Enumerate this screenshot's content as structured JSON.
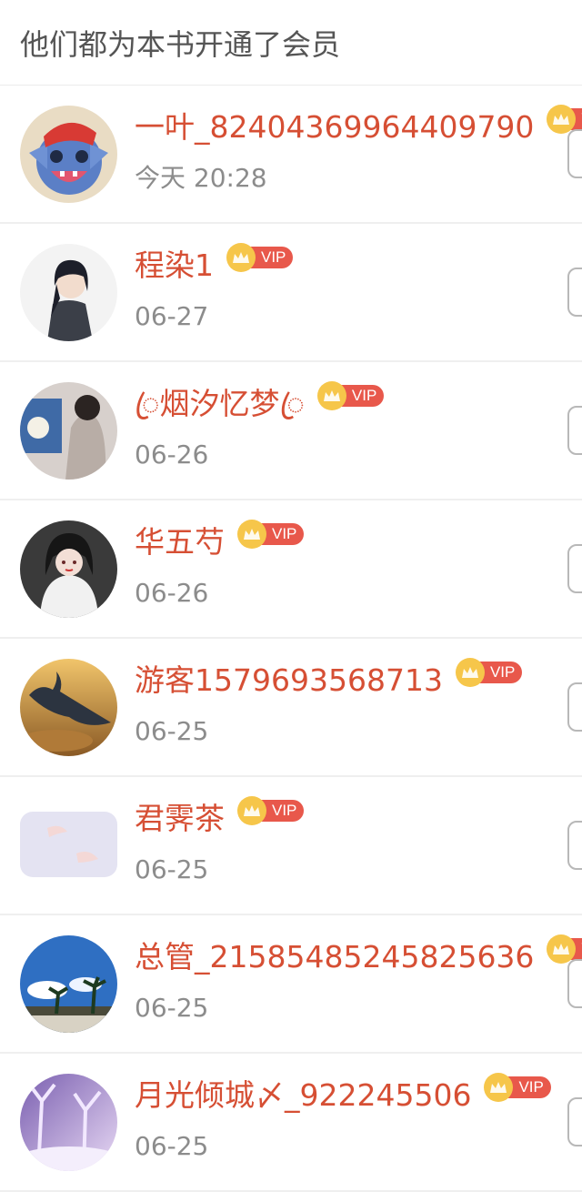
{
  "header": {
    "title": "他们都为本书开通了会员"
  },
  "vip_label": "VIP",
  "colors": {
    "name": "#d64f34",
    "time": "#8c8c8c",
    "vip": "#e8584b",
    "crown": "#f6c64a"
  },
  "members": [
    {
      "name": "一叶_82404369964409790",
      "time": "今天 20:28"
    },
    {
      "name": "程染1",
      "time": "06-27"
    },
    {
      "name": "ꦿ烟汐忆梦ꦿ",
      "time": "06-26"
    },
    {
      "name": "华五芍",
      "time": "06-26"
    },
    {
      "name": "游客1579693568713",
      "time": "06-25"
    },
    {
      "name": "君霁茶",
      "time": "06-25"
    },
    {
      "name": "总管_21585485245825636",
      "time": "06-25"
    },
    {
      "name": "月光倾城〆_922245506",
      "time": "06-25"
    }
  ]
}
